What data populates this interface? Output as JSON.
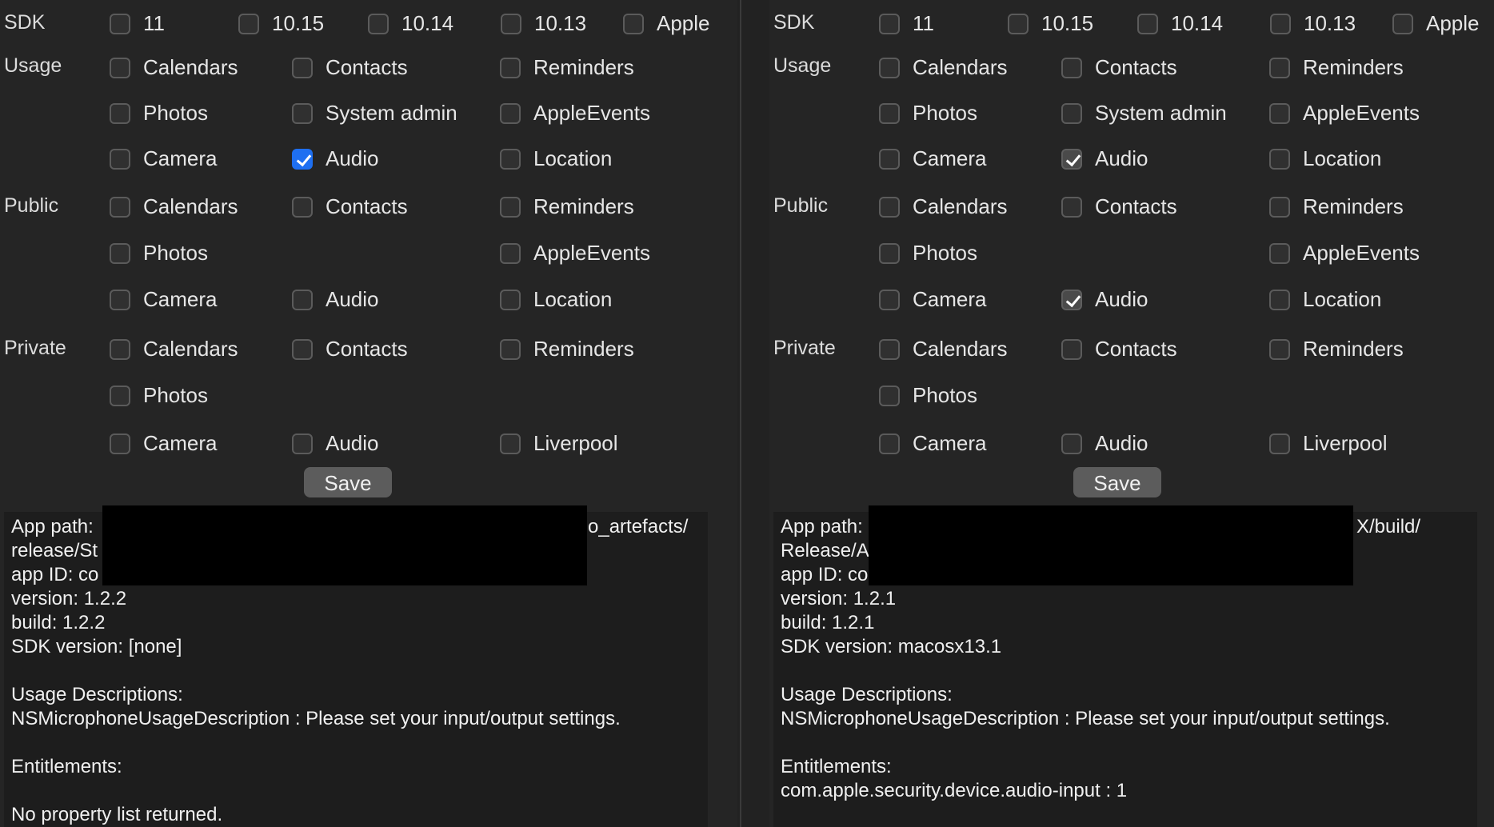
{
  "left": {
    "sdk": {
      "label": "SDK",
      "options": [
        "11",
        "10.15",
        "10.14",
        "10.13",
        "Apple"
      ]
    },
    "usage": {
      "label": "Usage",
      "items": [
        "Calendars",
        "Contacts",
        "Reminders",
        "Photos",
        "System admin",
        "AppleEvents",
        "Camera",
        "Audio",
        "Location"
      ]
    },
    "public": {
      "label": "Public",
      "items": [
        "Calendars",
        "Contacts",
        "Reminders",
        "Photos",
        "AppleEvents",
        "Camera",
        "Audio",
        "Location"
      ]
    },
    "private": {
      "label": "Private",
      "items": [
        "Calendars",
        "Contacts",
        "Reminders",
        "Photos",
        "Camera",
        "Audio",
        "Liverpool"
      ]
    },
    "save_label": "Save",
    "info": {
      "app_path_1": "App path:",
      "app_path_tail": "o_artefacts/",
      "app_path_2": "release/St",
      "app_id": "app ID: co",
      "version": "version: 1.2.2",
      "build": "build: 1.2.2",
      "sdk_version": "SDK version: [none]",
      "usage_header": "Usage Descriptions:",
      "usage_line": "NSMicrophoneUsageDescription : Please set your input/output settings.",
      "entitlements_header": "Entitlements:",
      "entitlements_line": "",
      "no_plist": "No property list returned."
    }
  },
  "right": {
    "sdk": {
      "label": "SDK",
      "options": [
        "11",
        "10.15",
        "10.14",
        "10.13",
        "Apple"
      ]
    },
    "usage": {
      "label": "Usage",
      "items": [
        "Calendars",
        "Contacts",
        "Reminders",
        "Photos",
        "System admin",
        "AppleEvents",
        "Camera",
        "Audio",
        "Location"
      ]
    },
    "public": {
      "label": "Public",
      "items": [
        "Calendars",
        "Contacts",
        "Reminders",
        "Photos",
        "AppleEvents",
        "Camera",
        "Audio",
        "Location"
      ]
    },
    "private": {
      "label": "Private",
      "items": [
        "Calendars",
        "Contacts",
        "Reminders",
        "Photos",
        "Camera",
        "Audio",
        "Liverpool"
      ]
    },
    "save_label": "Save",
    "info": {
      "app_path_1": "App path:",
      "app_path_tail": "X/build/",
      "app_path_2": "Release/A",
      "app_id": "app ID: co",
      "version": "version: 1.2.1",
      "build": "build: 1.2.1",
      "sdk_version": "SDK version: macosx13.1",
      "usage_header": "Usage Descriptions:",
      "usage_line": "NSMicrophoneUsageDescription : Please set your input/output settings.",
      "entitlements_header": "Entitlements:",
      "entitlements_line": "com.apple.security.device.audio-input : 1",
      "no_plist": ""
    }
  },
  "colors": {
    "checked_left": "#1e6ff1",
    "checked_right": "#4a4a4a",
    "background": "#252525"
  }
}
